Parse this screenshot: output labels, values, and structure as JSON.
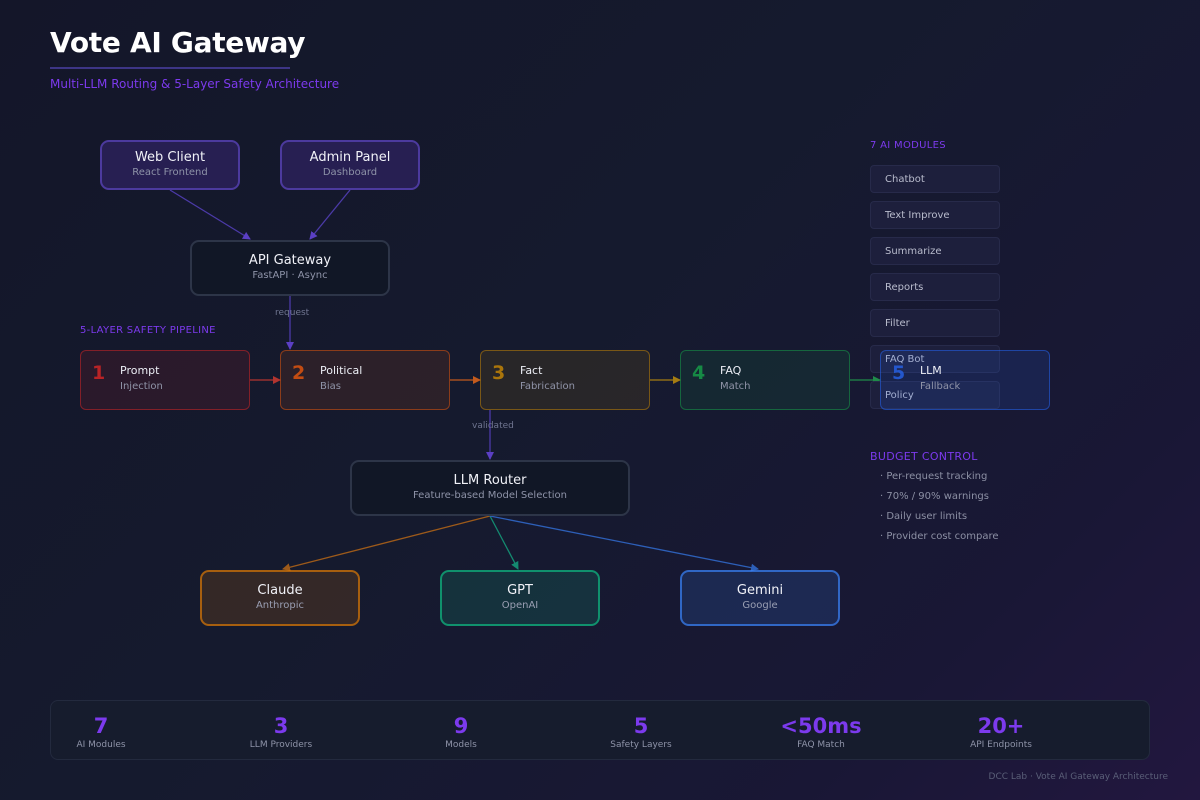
{
  "header": {
    "title": "Vote AI Gateway",
    "subtitle": "Multi-LLM Routing & 5-Layer Safety Architecture"
  },
  "clients": [
    {
      "title": "Web Client",
      "subtitle": "React Frontend"
    },
    {
      "title": "Admin Panel",
      "subtitle": "Dashboard"
    }
  ],
  "gateway": {
    "title": "API Gateway",
    "subtitle": "FastAPI · Async"
  },
  "flow_labels": {
    "request": "request",
    "validated": "validated"
  },
  "pipeline": {
    "label": "5-LAYER SAFETY PIPELINE",
    "layers": [
      {
        "num": "1",
        "title": "Prompt",
        "subtitle": "Injection",
        "color": "#dc2626"
      },
      {
        "num": "2",
        "title": "Political",
        "subtitle": "Bias",
        "color": "#ea580c"
      },
      {
        "num": "3",
        "title": "Fact",
        "subtitle": "Fabrication",
        "color": "#ca8a04"
      },
      {
        "num": "4",
        "title": "FAQ",
        "subtitle": "Match",
        "color": "#16a34a"
      },
      {
        "num": "5",
        "title": "LLM",
        "subtitle": "Fallback",
        "color": "#2563eb"
      }
    ]
  },
  "router": {
    "title": "LLM Router",
    "subtitle": "Feature-based Model Selection"
  },
  "providers": [
    {
      "title": "Claude",
      "subtitle": "Anthropic",
      "color": "#d97706"
    },
    {
      "title": "GPT",
      "subtitle": "OpenAI",
      "color": "#10b981"
    },
    {
      "title": "Gemini",
      "subtitle": "Google",
      "color": "#3b82f6"
    }
  ],
  "modules": {
    "label": "7 AI MODULES",
    "items": [
      "Chatbot",
      "Text Improve",
      "Summarize",
      "Reports",
      "Filter",
      "FAQ Bot",
      "Policy"
    ]
  },
  "budget": {
    "label": "BUDGET CONTROL",
    "items": [
      "· Per-request tracking",
      "· 70% / 90% warnings",
      "· Daily user limits",
      "· Provider cost compare"
    ]
  },
  "stats": [
    {
      "value": "7",
      "label": "AI Modules"
    },
    {
      "value": "3",
      "label": "LLM Providers"
    },
    {
      "value": "9",
      "label": "Models"
    },
    {
      "value": "5",
      "label": "Safety Layers"
    },
    {
      "value": "<50ms",
      "label": "FAQ Match"
    },
    {
      "value": "20+",
      "label": "API Endpoints"
    }
  ],
  "footer": "DCC Lab · Vote AI Gateway Architecture",
  "colors": {
    "accent": "#7c3aed",
    "background": "#151a2e"
  }
}
